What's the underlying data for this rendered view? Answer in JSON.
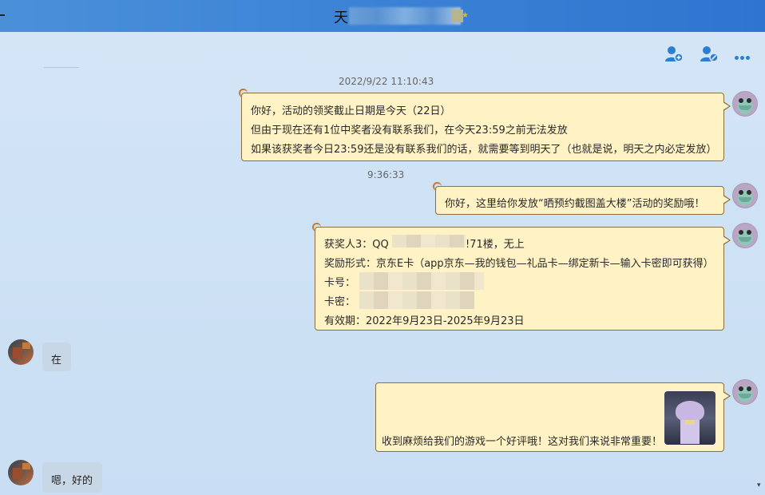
{
  "window": {
    "title": "天"
  },
  "toolbar": {
    "add_member_icon": "person-add-icon",
    "block_icon": "person-block-icon",
    "more_icon": "more-icon"
  },
  "timestamps": {
    "first": "2022/9/22 11:10:43",
    "second": "9:36:33"
  },
  "messages": {
    "m1": [
      "你好，活动的领奖截止日期是今天（22日）",
      "但由于现在还有1位中奖者没有联系我们，在今天23:59之前无法发放",
      "如果该获奖者今日23:59还是没有联系我们的话，就需要等到明天了（也就是说，明天之内必定发放）"
    ],
    "m2": "你好，这里给你发放“晒预约截图盖大楼”活动的奖励哦！",
    "m3": {
      "l1_prefix": "获奖人3：QQ",
      "l1_suffix": "!71楼，无上",
      "l2": "奖励形式：京东E卡（app京东—我的钱包—礼品卡—绑定新卡—输入卡密即可获得）",
      "l3": "卡号：",
      "l4": "卡密：",
      "l5": "有效期：2022年9月23日-2025年9月23日"
    },
    "reply1": "在",
    "m4": "收到麻烦给我们的游戏一个好评哦！这对我们来说非常重要！",
    "reply2": "嗯，好的"
  },
  "colors": {
    "bubble_fill": "#fff2c4",
    "bubble_border": "#8a6e3b",
    "title_bar": "#3b82d6",
    "reply_bubble": "#c8d7e6"
  }
}
